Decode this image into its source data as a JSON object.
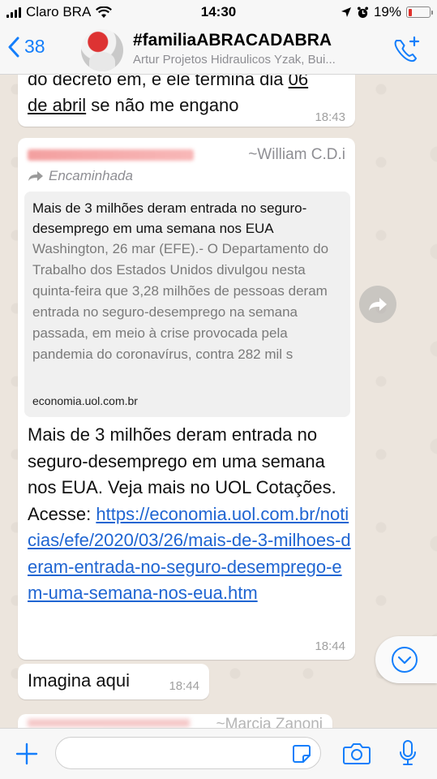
{
  "status_bar": {
    "carrier": "Claro BRA",
    "time": "14:30",
    "battery_percent": "19%",
    "battery_level": 0.19
  },
  "header": {
    "back_count": "38",
    "title": "#familiaABRACADABRA",
    "subtitle": "Artur Projetos Hidraulicos Yzak, Bui..."
  },
  "messages": [
    {
      "line1_pre": "do decreto em, e ele termina dia ",
      "line1_ul": "06",
      "line2_ul": "de abril",
      "line2_post": " se não me engano",
      "time": "18:43"
    },
    {
      "sender": "~William C.D.i",
      "forwarded_label": "Encaminhada",
      "preview_title": "Mais de 3 milhões deram entrada no seguro-desemprego em uma semana nos EUA",
      "preview_desc": "Washington, 26 mar (EFE).- O Departamento do Trabalho dos Estados Unidos divulgou nesta quinta-feira que 3,28 milhões de pessoas deram entrada no seguro-desemprego na semana passada, em meio à crise provocada pela pandemia do coronavírus, contra 282 mil s",
      "preview_domain": "economia.uol.com.br",
      "body_text": "Mais de 3 milhões deram entrada no seguro-desemprego em uma semana nos EUA. Veja mais no UOL Cotações. Acesse: ",
      "link": "https://economia.uol.com.br/noticias/efe/2020/03/26/mais-de-3-milhoes-deram-entrada-no-seguro-desemprego-em-uma-semana-nos-eua.htm",
      "time": "18:44"
    },
    {
      "text": "Imagina aqui",
      "time": "18:44"
    },
    {
      "sender": "~Marcia Zanoni"
    }
  ],
  "input": {
    "placeholder": ""
  },
  "colors": {
    "accent": "#147efb",
    "link": "#1f65d2",
    "bubble": "#ffffff"
  }
}
